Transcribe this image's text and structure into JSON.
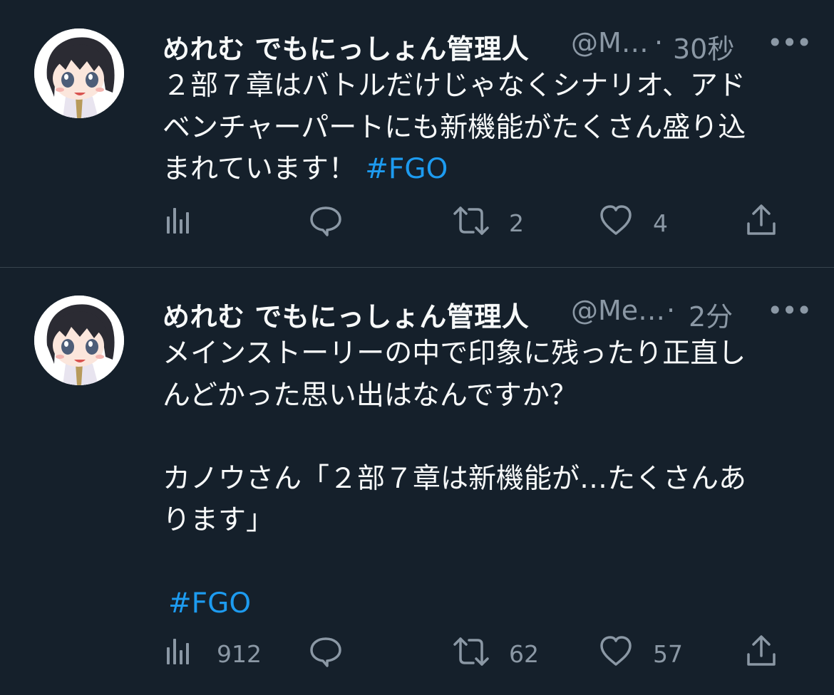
{
  "colors": {
    "background": "#15202b",
    "text": "#f7f9f9",
    "secondary_text": "#8b98a5",
    "hashtag": "#1d9bf0",
    "divider": "#38444d"
  },
  "tweets": [
    {
      "display_name": "めれむ でもにっしょん管理人",
      "handle": "@M…",
      "separator": "·",
      "time": "30秒",
      "more": "•••",
      "text_lines": [
        "２部７章はバトルだけじゃなくシナリオ、アド",
        "ベンチャーパートにも新機能がたくさん盛り込",
        "まれています！ "
      ],
      "hashtag": "#FGO",
      "views": "",
      "replies": "",
      "retweets": "2",
      "likes": "4",
      "icons": {
        "views": "analytics-icon",
        "reply": "reply-icon",
        "retweet": "retweet-icon",
        "like": "heart-icon",
        "share": "share-icon"
      }
    },
    {
      "display_name": "めれむ でもにっしょん管理人",
      "handle": "@Me…",
      "separator": "·",
      "time": "2分",
      "more": "•••",
      "text_lines": [
        "メインストーリーの中で印象に残ったり正直し",
        "んどかった思い出はなんですか？",
        "",
        "カノウさん「２部７章は新機能が…たくさんあ",
        "ります」",
        ""
      ],
      "hashtag": "#FGO",
      "views": "912",
      "replies": "",
      "retweets": "62",
      "likes": "57",
      "icons": {
        "views": "analytics-icon",
        "reply": "reply-icon",
        "retweet": "retweet-icon",
        "like": "heart-icon",
        "share": "share-icon"
      }
    }
  ]
}
